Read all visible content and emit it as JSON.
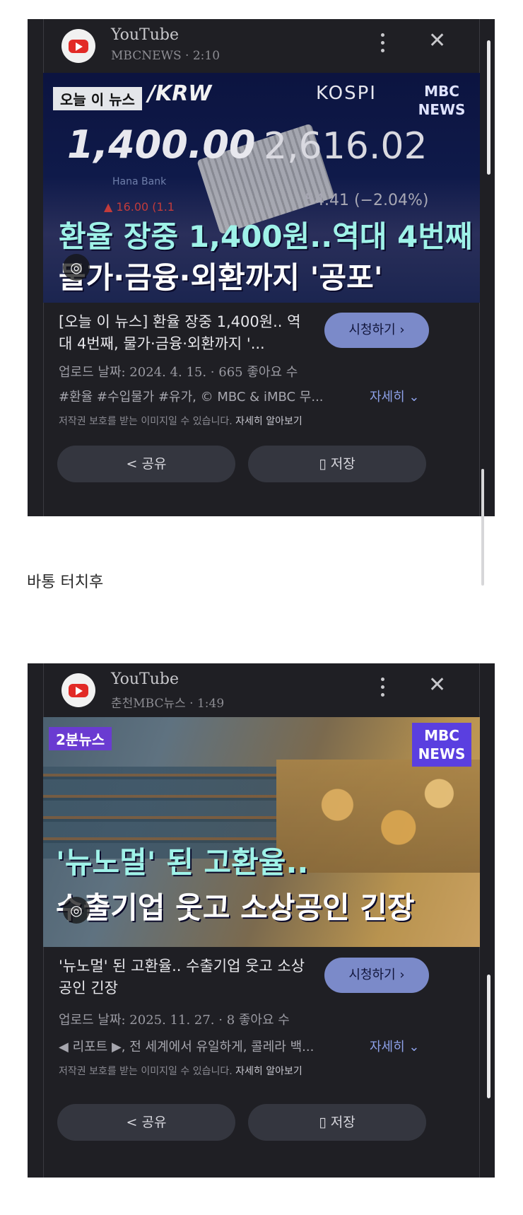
{
  "cards": [
    {
      "source": "YouTube",
      "channel_duration": "MBCNEWS · 2:10",
      "thumb": {
        "badge": "오늘 이 뉴스",
        "krw_label": "/KRW",
        "kospi_label": "KOSPI",
        "mbc_logo": "MBC NEWS",
        "rate": "1,400.00",
        "kospi_value": "2,616.02",
        "bank": "Hana Bank",
        "rate_change": "▲ 16.00 (1.1",
        "kospi_change": "54.41 (−2.04%)",
        "headline_1": "환율 장중 1,400원..역대 4번째",
        "headline_2": "물가·금융·외환까지 '공포'"
      },
      "title": "[오늘 이 뉴스] 환율 장중 1,400원.. 역대 4번째, 물가·금융·외환까지 '...",
      "watch_label": "시청하기 ›",
      "meta": "업로드 날짜: 2024. 4. 15. · 665 좋아요 수",
      "tags": "#환율 #수입물가 #유가, © MBC & iMBC 무...",
      "more_label": "자세히 ⌄",
      "copyright": "저작권 보호를 받는 이미지일 수 있습니다.",
      "learn_more": "자세히 알아보기",
      "share_label": "공유",
      "save_label": "저장"
    },
    {
      "source": "YouTube",
      "channel_duration": "춘천MBC뉴스 · 1:49",
      "thumb": {
        "badge": "2분뉴스",
        "mbc_logo": "MBC NEWS",
        "headline_1": "'뉴노멀' 된 고환율..",
        "headline_2": "수출기업 웃고 소상공인 긴장"
      },
      "title": "'뉴노멀' 된 고환율.. 수출기업 웃고 소상공인 긴장",
      "watch_label": "시청하기 ›",
      "meta": "업로드 날짜: 2025. 11. 27. · 8 좋아요 수",
      "tags": "◀ 리포트 ▶, 전 세계에서 유일하게, 콜레라 백...",
      "more_label": "자세히 ⌄",
      "copyright": "저작권 보호를 받는 이미지일 수 있습니다.",
      "learn_more": "자세히 알아보기",
      "share_label": "공유",
      "save_label": "저장"
    }
  ],
  "caption": "바통 터치후",
  "icons": [
    "youtube-logo-icon",
    "more-vert-icon",
    "close-icon",
    "lens-icon",
    "share-icon",
    "bookmark-icon"
  ]
}
